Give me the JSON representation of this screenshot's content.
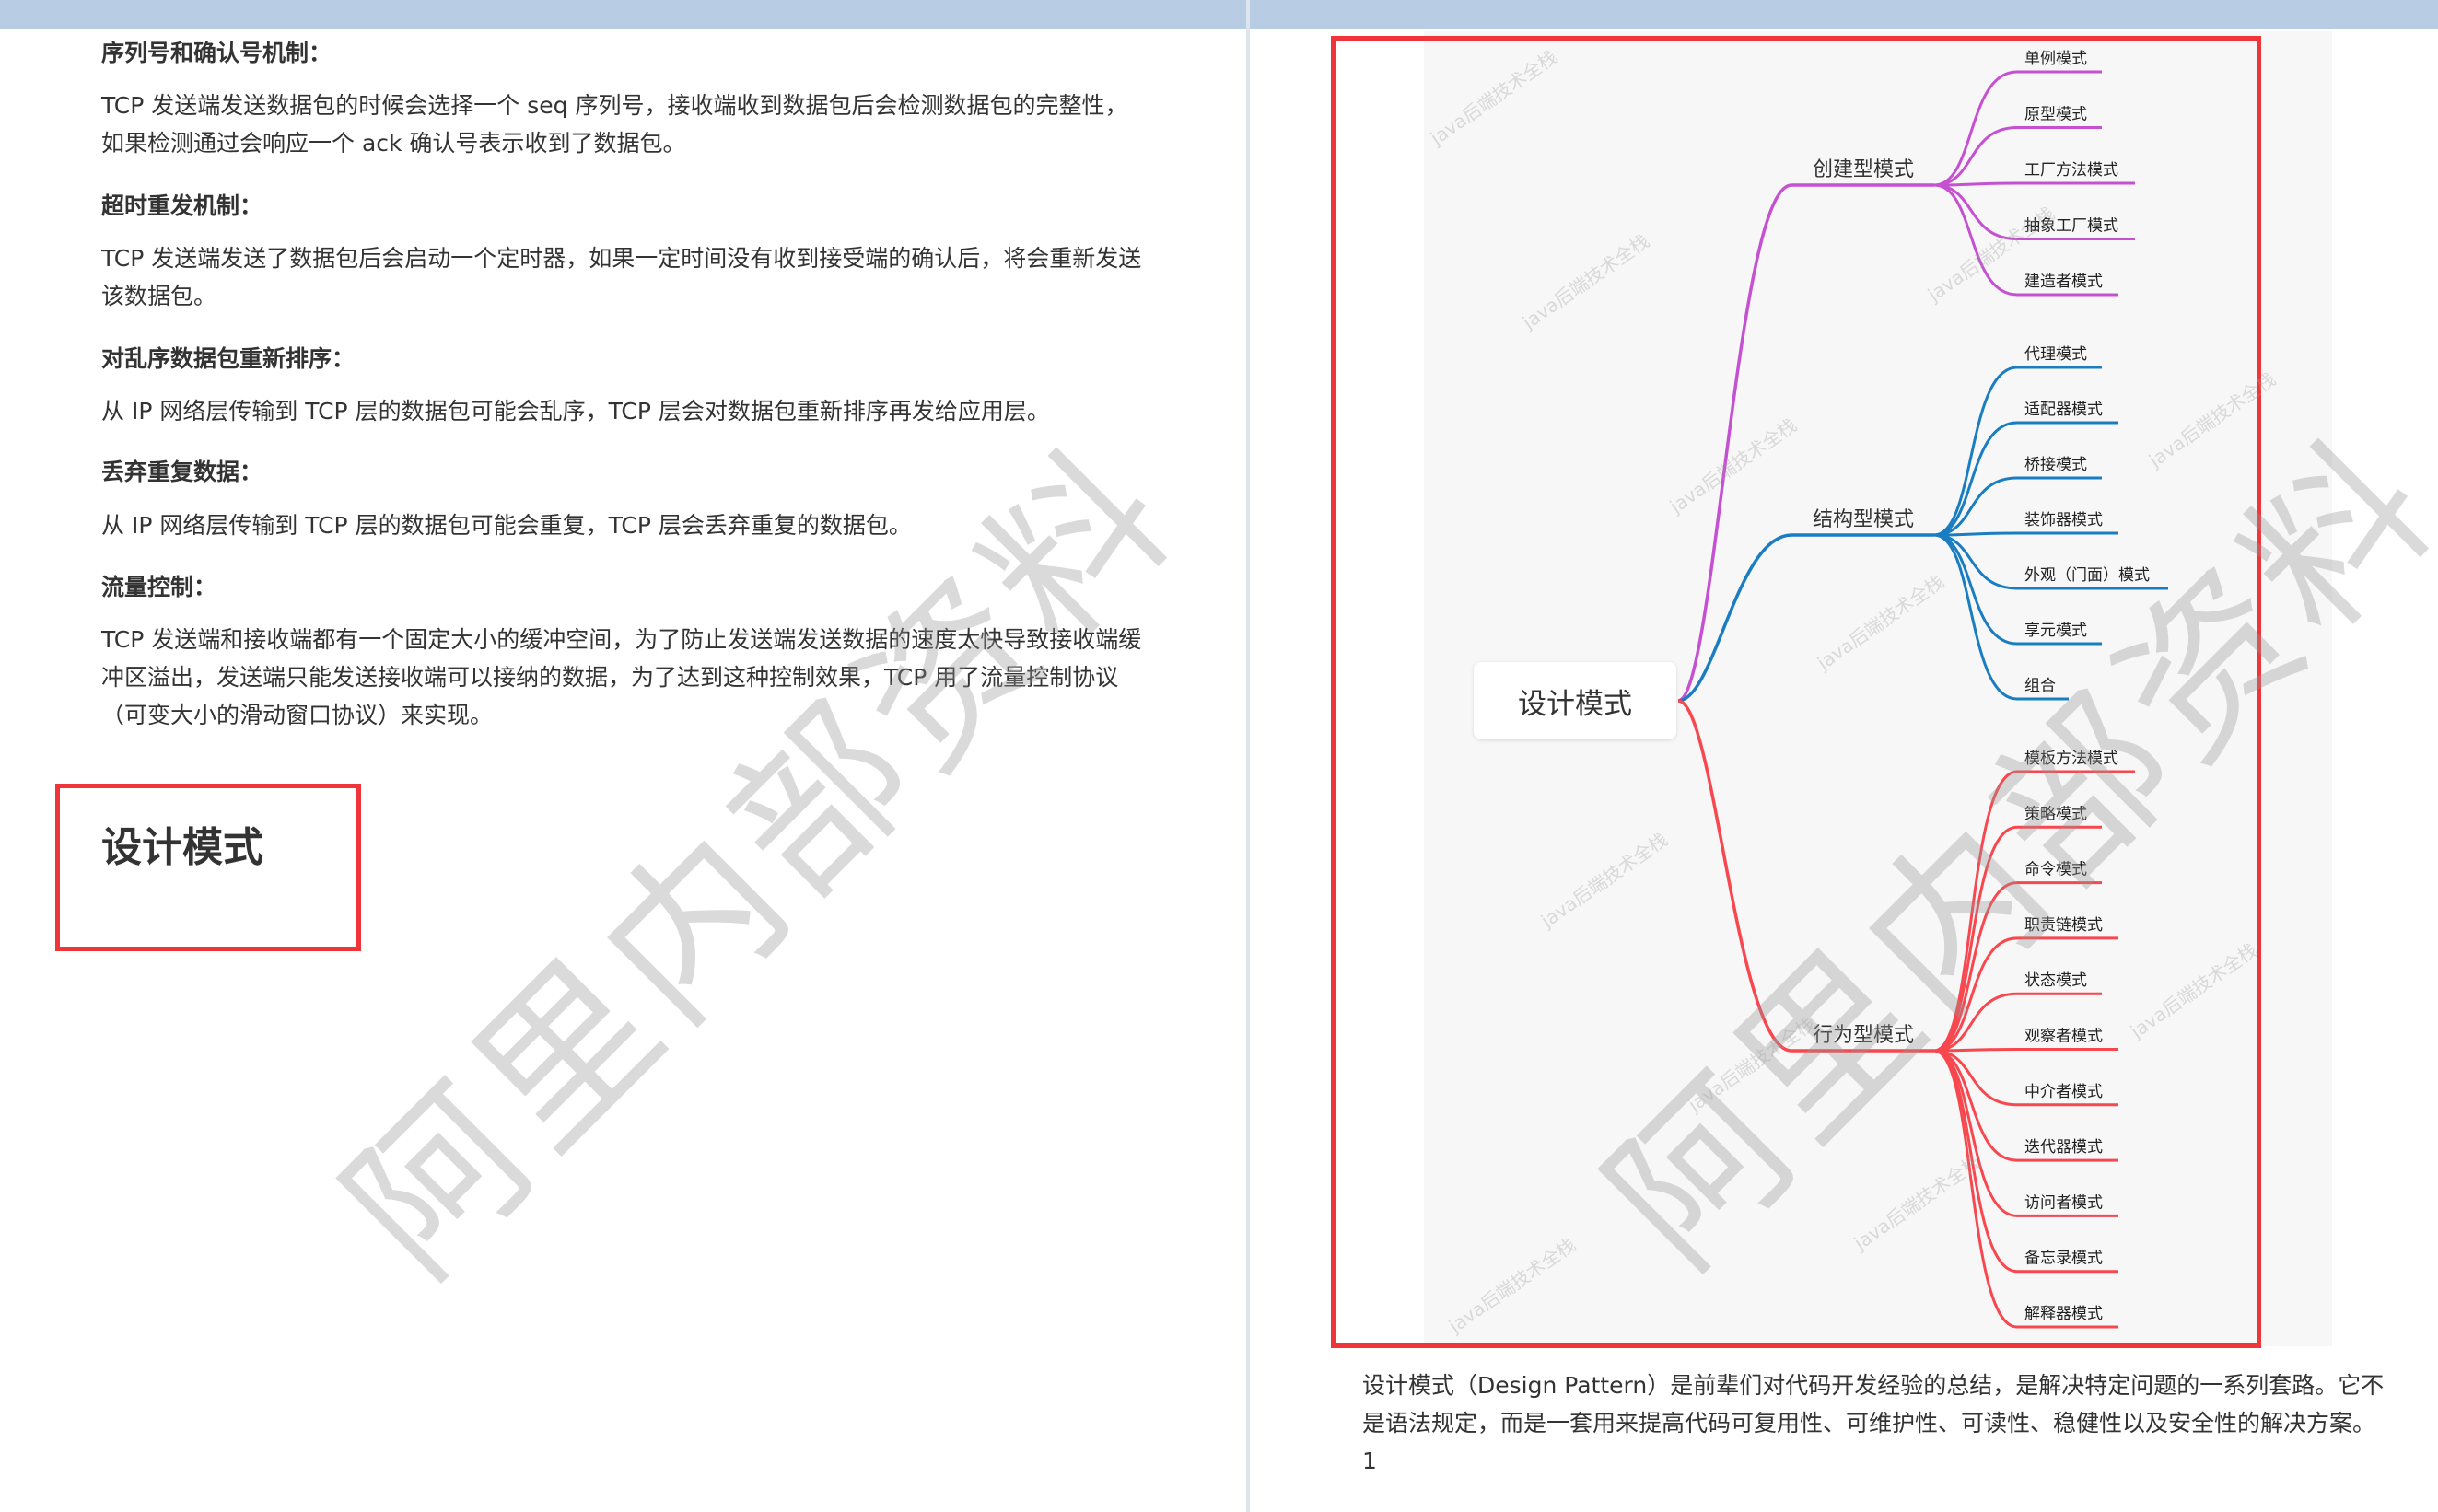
{
  "left_page": {
    "sections": [
      {
        "heading": "序列号和确认号机制：",
        "paragraph": "TCP 发送端发送数据包的时候会选择一个 seq 序列号，接收端收到数据包后会检测数据包的完整性，如果检测通过会响应一个 ack 确认号表示收到了数据包。"
      },
      {
        "heading": "超时重发机制：",
        "paragraph": "TCP 发送端发送了数据包后会启动一个定时器，如果一定时间没有收到接受端的确认后，将会重新发送该数据包。"
      },
      {
        "heading": "对乱序数据包重新排序：",
        "paragraph": "从 IP 网络层传输到 TCP 层的数据包可能会乱序，TCP 层会对数据包重新排序再发给应用层。"
      },
      {
        "heading": "丢弃重复数据：",
        "paragraph": "从 IP 网络层传输到 TCP 层的数据包可能会重复，TCP 层会丢弃重复的数据包。"
      },
      {
        "heading": "流量控制：",
        "paragraph": "TCP 发送端和接收端都有一个固定大小的缓冲空间，为了防止发送端发送数据的速度太快导致接收端缓冲区溢出，发送端只能发送接收端可以接纳的数据，为了达到这种控制效果，TCP 用了流量控制协议（可变大小的滑动窗口协议）来实现。"
      }
    ],
    "section_title": "设计模式"
  },
  "mindmap": {
    "root": "设计模式",
    "branches": [
      {
        "label": "创建型模式",
        "color": "#c650d2",
        "leaves": [
          "单例模式",
          "原型模式",
          "工厂方法模式",
          "抽象工厂模式",
          "建造者模式"
        ]
      },
      {
        "label": "结构型模式",
        "color": "#1a7dc2",
        "leaves": [
          "代理模式",
          "适配器模式",
          "桥接模式",
          "装饰器模式",
          "外观（门面）模式",
          "享元模式",
          "组合"
        ]
      },
      {
        "label": "行为型模式",
        "color": "#f7474f",
        "leaves": [
          "模板方法模式",
          "策略模式",
          "命令模式",
          "职责链模式",
          "状态模式",
          "观察者模式",
          "中介者模式",
          "迭代器模式",
          "访问者模式",
          "备忘录模式",
          "解释器模式"
        ]
      }
    ]
  },
  "caption": "设计模式（Design Pattern）是前辈们对代码开发经验的总结，是解决特定问题的一系列套路。它不是语法规定，而是一套用来提高代码可复用性、可维护性、可读性、稳健性以及安全性的解决方案。1",
  "watermark": {
    "main": "阿里内部资料",
    "small": "java后端技术全栈"
  },
  "colors": {
    "highlight": "#f0353a",
    "topbar": "#b8cce4"
  }
}
